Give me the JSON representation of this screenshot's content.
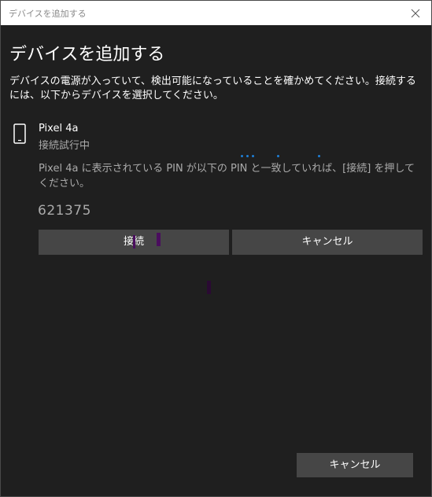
{
  "window": {
    "title": "デバイスを追加する"
  },
  "dialog": {
    "heading": "デバイスを追加する",
    "instruction": "デバイスの電源が入っていて、検出可能になっていることを確かめてください。接続するには、以下からデバイスを選択してください。"
  },
  "device": {
    "icon": "phone-icon",
    "name": "Pixel 4a",
    "status": "接続試行中"
  },
  "pairing": {
    "message": "Pixel 4a に表示されている PIN が以下の PIN と一致していれば、[接続] を押してください。",
    "pin": "621375",
    "connect_label": "接続",
    "cancel_label": "キャンセル"
  },
  "footer": {
    "cancel_label": "キャンセル"
  },
  "colors": {
    "background": "#1f1f1f",
    "button": "#464646",
    "accent": "#1e7fd6",
    "text": "#ffffff",
    "muted_text": "#aaaaaa"
  }
}
